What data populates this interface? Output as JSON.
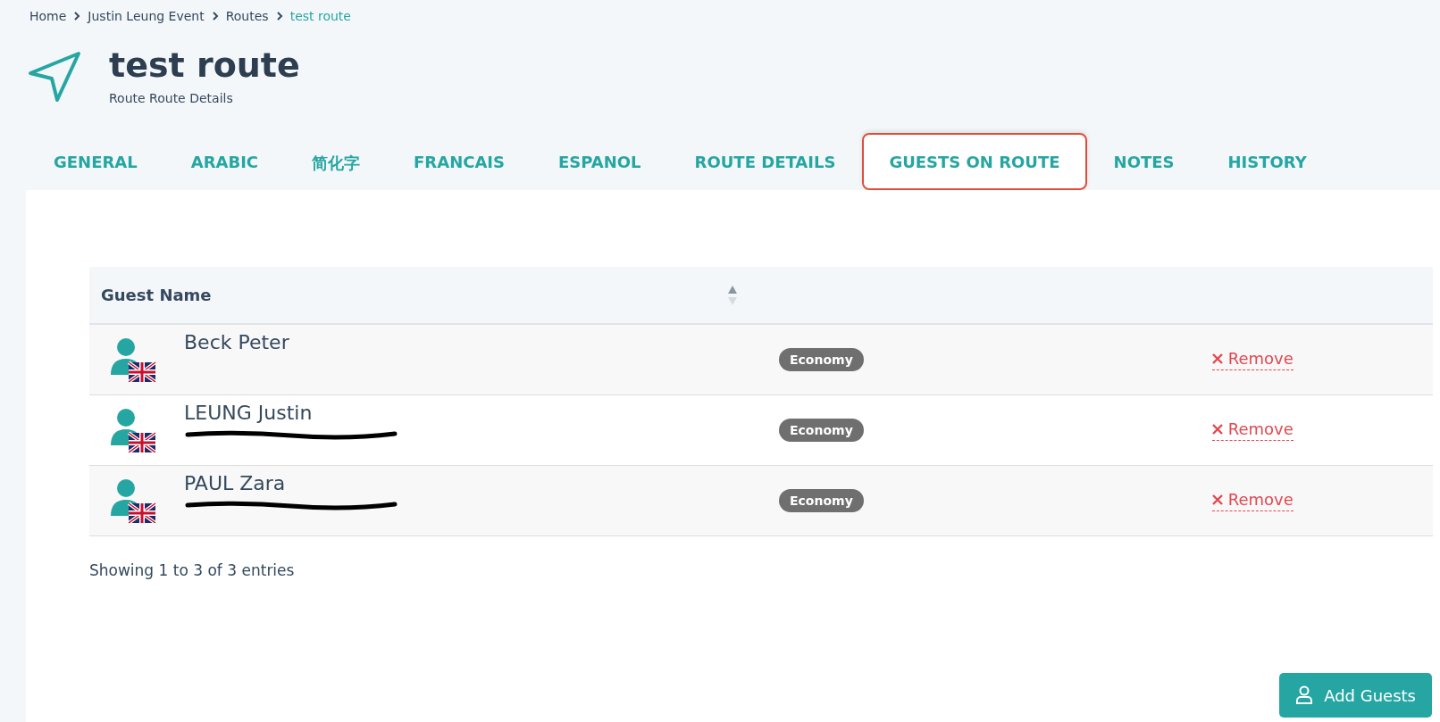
{
  "breadcrumb": [
    {
      "label": "Home",
      "current": false
    },
    {
      "label": "Justin Leung Event",
      "current": false
    },
    {
      "label": "Routes",
      "current": false
    },
    {
      "label": "test route",
      "current": true
    }
  ],
  "header": {
    "title": "test route",
    "subtitle": "Route Route Details"
  },
  "tabs": [
    {
      "label": "GENERAL",
      "selected": false,
      "highlighted": false
    },
    {
      "label": "ARABIC",
      "selected": false,
      "highlighted": false
    },
    {
      "label": "简化字",
      "selected": false,
      "highlighted": false
    },
    {
      "label": "FRANCAIS",
      "selected": false,
      "highlighted": false
    },
    {
      "label": "ESPANOL",
      "selected": false,
      "highlighted": false
    },
    {
      "label": "ROUTE DETAILS",
      "selected": false,
      "highlighted": false
    },
    {
      "label": "GUESTS ON ROUTE",
      "selected": true,
      "highlighted": true
    },
    {
      "label": "NOTES",
      "selected": false,
      "highlighted": false
    },
    {
      "label": "HISTORY",
      "selected": false,
      "highlighted": false
    }
  ],
  "table": {
    "columns": [
      "Guest Name"
    ],
    "rows": [
      {
        "name": "Beck Peter",
        "email_redacted": false,
        "class": "Economy",
        "action": "Remove"
      },
      {
        "name": "LEUNG Justin",
        "email_redacted": true,
        "class": "Economy",
        "action": "Remove"
      },
      {
        "name": "PAUL Zara",
        "email_redacted": true,
        "class": "Economy",
        "action": "Remove"
      }
    ]
  },
  "footer": "Showing 1 to 3 of 3 entries",
  "add_button": "Add Guests"
}
